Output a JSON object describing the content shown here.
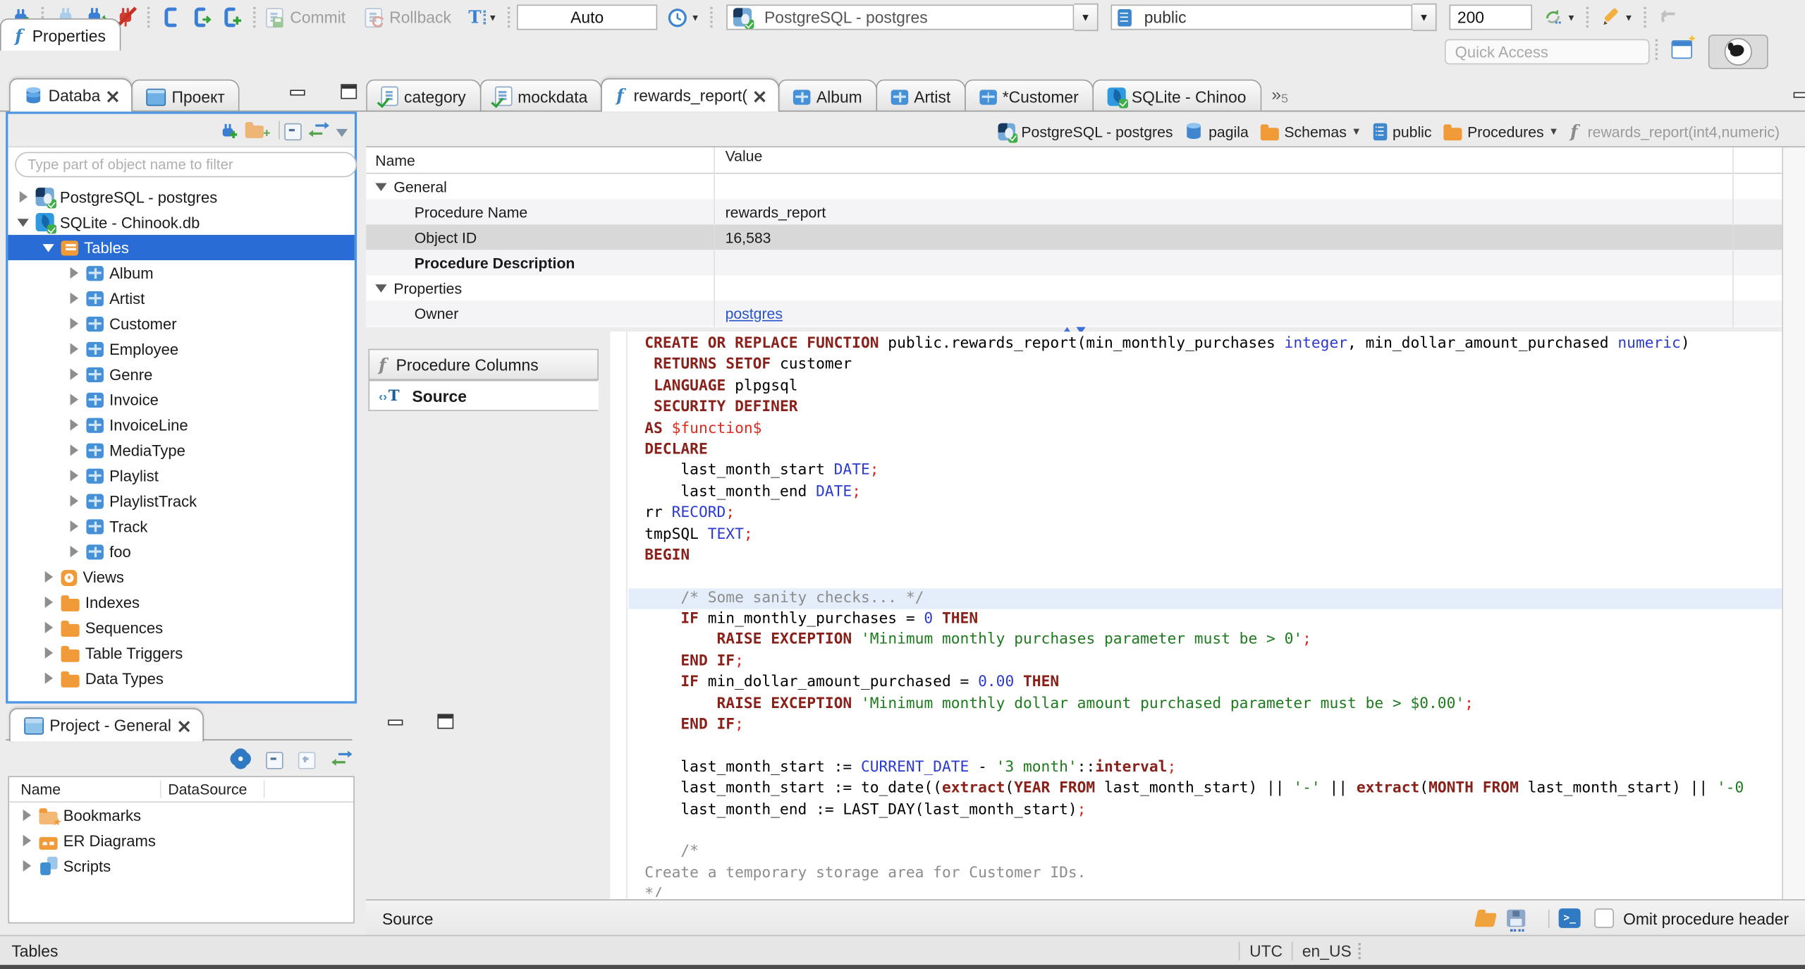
{
  "toolbar": {
    "commit_label": "Commit",
    "rollback_label": "Rollback",
    "tx_mode": "Auto",
    "fetch_size": "200",
    "connection": "PostgreSQL - postgres",
    "schema": "public",
    "quick_access_placeholder": "Quick Access"
  },
  "editor_tabs": [
    {
      "label": "category",
      "icon": "sql-script"
    },
    {
      "label": "mockdata",
      "icon": "sql-script"
    },
    {
      "label": "rewards_report(",
      "icon": "function",
      "active": true
    },
    {
      "label": "Album",
      "icon": "table"
    },
    {
      "label": "Artist",
      "icon": "table"
    },
    {
      "label": "*Customer",
      "icon": "table"
    },
    {
      "label": "SQLite - Chinoo",
      "icon": "database"
    }
  ],
  "tab_overflow_count": "5",
  "sidebar": {
    "tabs": [
      {
        "label": "Databa"
      },
      {
        "label": "Проект"
      }
    ],
    "filter_placeholder": "Type part of object name to filter",
    "tree": [
      {
        "label": "PostgreSQL - postgres",
        "icon": "postgres-connection",
        "depth": 0,
        "state": "collapsed"
      },
      {
        "label": "SQLite - Chinook.db",
        "icon": "sqlite-connection",
        "depth": 0,
        "state": "expanded"
      },
      {
        "label": "Tables",
        "icon": "tables-folder",
        "depth": 1,
        "state": "expanded",
        "selected": true
      },
      {
        "label": "Album",
        "icon": "table",
        "depth": 2,
        "state": "collapsed"
      },
      {
        "label": "Artist",
        "icon": "table",
        "depth": 2,
        "state": "collapsed"
      },
      {
        "label": "Customer",
        "icon": "table",
        "depth": 2,
        "state": "collapsed"
      },
      {
        "label": "Employee",
        "icon": "table",
        "depth": 2,
        "state": "collapsed"
      },
      {
        "label": "Genre",
        "icon": "table",
        "depth": 2,
        "state": "collapsed"
      },
      {
        "label": "Invoice",
        "icon": "table",
        "depth": 2,
        "state": "collapsed"
      },
      {
        "label": "InvoiceLine",
        "icon": "table",
        "depth": 2,
        "state": "collapsed"
      },
      {
        "label": "MediaType",
        "icon": "table",
        "depth": 2,
        "state": "collapsed"
      },
      {
        "label": "Playlist",
        "icon": "table",
        "depth": 2,
        "state": "collapsed"
      },
      {
        "label": "PlaylistTrack",
        "icon": "table",
        "depth": 2,
        "state": "collapsed"
      },
      {
        "label": "Track",
        "icon": "table",
        "depth": 2,
        "state": "collapsed"
      },
      {
        "label": "foo",
        "icon": "table",
        "depth": 2,
        "state": "collapsed"
      },
      {
        "label": "Views",
        "icon": "views-eye",
        "depth": 1,
        "state": "collapsed"
      },
      {
        "label": "Indexes",
        "icon": "folder",
        "depth": 1,
        "state": "collapsed"
      },
      {
        "label": "Sequences",
        "icon": "folder",
        "depth": 1,
        "state": "collapsed"
      },
      {
        "label": "Table Triggers",
        "icon": "folder",
        "depth": 1,
        "state": "collapsed"
      },
      {
        "label": "Data Types",
        "icon": "folder",
        "depth": 1,
        "state": "collapsed"
      }
    ]
  },
  "project_panel": {
    "title": "Project - General",
    "columns": [
      "Name",
      "DataSource"
    ],
    "items": [
      {
        "label": "Bookmarks",
        "icon": "bookmarks-folder"
      },
      {
        "label": "ER Diagrams",
        "icon": "er-diagrams-folder"
      },
      {
        "label": "Scripts",
        "icon": "scripts"
      }
    ]
  },
  "properties_panel": {
    "tab_label": "Properties",
    "connection_label": "PostgreSQL - postgres",
    "breadcrumb": [
      {
        "label": "PostgreSQL - postgres",
        "icon": "postgres-connection"
      },
      {
        "label": "pagila",
        "icon": "database-cylinder"
      },
      {
        "label": "Schemas",
        "icon": "folder",
        "dropdown": true
      },
      {
        "label": "public",
        "icon": "schema-page"
      },
      {
        "label": "Procedures",
        "icon": "folder",
        "dropdown": true
      },
      {
        "label": "rewards_report(int4,numeric)",
        "icon": "function",
        "muted": true
      }
    ],
    "columns": {
      "name": "Name",
      "value": "Value"
    },
    "rows": [
      {
        "name": "General",
        "value": "",
        "group": true,
        "state": "expanded"
      },
      {
        "name": "Procedure Name",
        "value": "rewards_report"
      },
      {
        "name": "Object ID",
        "value": "16,583",
        "selected": true
      },
      {
        "name": "Procedure Description",
        "value": "",
        "bold": true
      },
      {
        "name": "Properties",
        "value": "",
        "group": true,
        "state": "expanded"
      },
      {
        "name": "Owner",
        "value": "postgres",
        "link": true
      }
    ]
  },
  "subtabs": {
    "procedure_columns": "Procedure Columns",
    "source": "Source"
  },
  "source_bar": {
    "label": "Source",
    "omit_checkbox_label": "Omit procedure header",
    "omit_checked": false
  },
  "status_bar": {
    "context": "Tables",
    "timezone": "UTC",
    "locale": "en_US"
  },
  "colors": {
    "selection_blue": "#2a6cd6",
    "focus_border": "#4c95e5",
    "code_keyword": "#8a201a",
    "code_type": "#2b3bd0",
    "code_string": "#1d7a1d",
    "code_comment": "#8c8c8c",
    "code_punct_red": "#d92520",
    "link_blue": "#2753cc"
  },
  "code": {
    "highlight": 12,
    "lines": [
      [
        [
          "kw",
          "CREATE OR REPLACE FUNCTION "
        ],
        [
          "pl",
          "public.rewards_report(min_monthly_purchases "
        ],
        [
          "ty",
          "integer"
        ],
        [
          "pl",
          ", min_dollar_amount_purchased "
        ],
        [
          "ty",
          "numeric"
        ],
        [
          "pl",
          ")"
        ]
      ],
      [
        [
          "pl",
          " "
        ],
        [
          "kw",
          "RETURNS SETOF "
        ],
        [
          "pl",
          "customer"
        ]
      ],
      [
        [
          "pl",
          " "
        ],
        [
          "kw",
          "LANGUAGE "
        ],
        [
          "pl",
          "plpgsql"
        ]
      ],
      [
        [
          "pl",
          " "
        ],
        [
          "kw",
          "SECURITY DEFINER"
        ]
      ],
      [
        [
          "kw",
          "AS "
        ],
        [
          "fn",
          "$function$"
        ]
      ],
      [
        [
          "kw",
          "DECLARE"
        ]
      ],
      [
        [
          "pl",
          "    last_month_start "
        ],
        [
          "ty",
          "DATE"
        ],
        [
          "red",
          ";"
        ]
      ],
      [
        [
          "pl",
          "    last_month_end "
        ],
        [
          "ty",
          "DATE"
        ],
        [
          "red",
          ";"
        ]
      ],
      [
        [
          "pl",
          "rr "
        ],
        [
          "ty",
          "RECORD"
        ],
        [
          "red",
          ";"
        ]
      ],
      [
        [
          "pl",
          "tmpSQL "
        ],
        [
          "ty",
          "TEXT"
        ],
        [
          "red",
          ";"
        ]
      ],
      [
        [
          "kw",
          "BEGIN"
        ]
      ],
      [],
      [
        [
          "cm",
          "    /* Some sanity checks... */"
        ]
      ],
      [
        [
          "pl",
          "    "
        ],
        [
          "kw",
          "IF"
        ],
        [
          "pl",
          " min_monthly_purchases = "
        ],
        [
          "ty",
          "0"
        ],
        [
          "pl",
          " "
        ],
        [
          "kw",
          "THEN"
        ]
      ],
      [
        [
          "pl",
          "        "
        ],
        [
          "kw",
          "RAISE EXCEPTION "
        ],
        [
          "st",
          "'Minimum monthly purchases parameter must be > 0'"
        ],
        [
          "red",
          ";"
        ]
      ],
      [
        [
          "pl",
          "    "
        ],
        [
          "kw",
          "END IF"
        ],
        [
          "red",
          ";"
        ]
      ],
      [
        [
          "pl",
          "    "
        ],
        [
          "kw",
          "IF"
        ],
        [
          "pl",
          " min_dollar_amount_purchased = "
        ],
        [
          "ty",
          "0.00"
        ],
        [
          "pl",
          " "
        ],
        [
          "kw",
          "THEN"
        ]
      ],
      [
        [
          "pl",
          "        "
        ],
        [
          "kw",
          "RAISE EXCEPTION "
        ],
        [
          "st",
          "'Minimum monthly dollar amount purchased parameter must be > $0.00'"
        ],
        [
          "red",
          ";"
        ]
      ],
      [
        [
          "pl",
          "    "
        ],
        [
          "kw",
          "END IF"
        ],
        [
          "red",
          ";"
        ]
      ],
      [],
      [
        [
          "pl",
          "    last_month_start := "
        ],
        [
          "ty",
          "CURRENT_DATE"
        ],
        [
          "pl",
          " - "
        ],
        [
          "st",
          "'3 month'"
        ],
        [
          "pl",
          "::"
        ],
        [
          "kw",
          "interval"
        ],
        [
          "red",
          ";"
        ]
      ],
      [
        [
          "pl",
          "    last_month_start := to_date(("
        ],
        [
          "kw",
          "extract"
        ],
        [
          "pl",
          "("
        ],
        [
          "kw",
          "YEAR FROM"
        ],
        [
          "pl",
          " last_month_start) || "
        ],
        [
          "st",
          "'-'"
        ],
        [
          "pl",
          " || "
        ],
        [
          "kw",
          "extract"
        ],
        [
          "pl",
          "("
        ],
        [
          "kw",
          "MONTH FROM"
        ],
        [
          "pl",
          " last_month_start) || "
        ],
        [
          "st",
          "'-0"
        ]
      ],
      [
        [
          "pl",
          "    last_month_end := LAST_DAY(last_month_start)"
        ],
        [
          "red",
          ";"
        ]
      ],
      [],
      [
        [
          "cm",
          "    /*"
        ]
      ],
      [
        [
          "cm",
          "Create a temporary storage area for Customer IDs."
        ]
      ],
      [
        [
          "cm",
          "*/"
        ]
      ]
    ]
  }
}
